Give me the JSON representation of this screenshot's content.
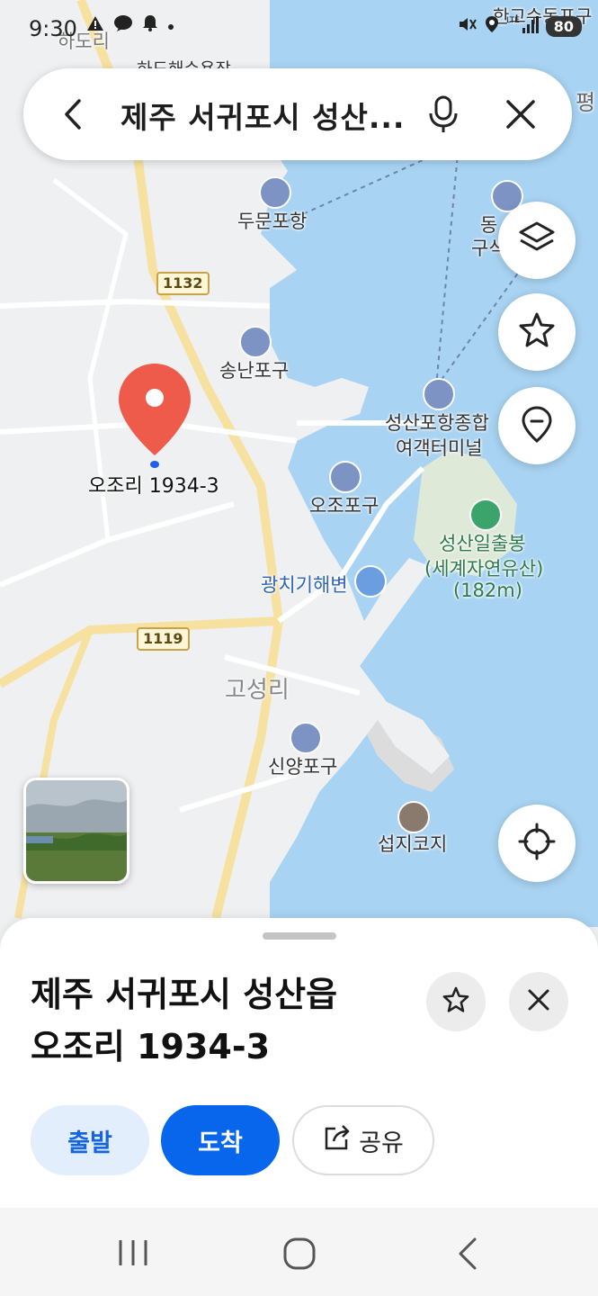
{
  "status_bar": {
    "time": "9:30",
    "battery": "80",
    "notification_icons": [
      "warning-icon",
      "talk-icon",
      "bell-icon",
      "dot-icon"
    ],
    "system_icons": [
      "mute-icon",
      "location-icon",
      "lte-signal-icon"
    ]
  },
  "search": {
    "query": "제주 서귀포시 성산..."
  },
  "map": {
    "place_labels": {
      "ojori_top": "하도리",
      "haedong": "하도해수욕장",
      "dumun": "두문포항",
      "dong_a": "동",
      "dong_b": "구석",
      "songnan": "송난포구",
      "seongsan_a": "성산포항종합",
      "seongsan_b": "여객터미널",
      "ojo_port": "오조포구",
      "ilchulbong_a": "성산일출봉",
      "ilchulbong_b": "(세계자연유산)",
      "ilchulbong_c": "(182m)",
      "gwangchigi": "광치기해변",
      "goseong": "고성리",
      "sinyang": "신양포구",
      "seopjikoji": "섭지코지",
      "top_right": "한고수동포구",
      "edge_pyeong": "평"
    },
    "road_tags": {
      "r1132": "1132",
      "r1119": "1119"
    },
    "pin_label": "오조리 1934-3",
    "accent_color": "#ef5b4a",
    "water_color": "#a8d3f2",
    "land_color": "#eef0f2"
  },
  "sheet": {
    "title_line1": "제주 서귀포시 성산읍",
    "title_line2": "오조리 1934-3",
    "depart_label": "출발",
    "arrive_label": "도착",
    "share_label": "공유",
    "primary_color": "#0766ec"
  }
}
